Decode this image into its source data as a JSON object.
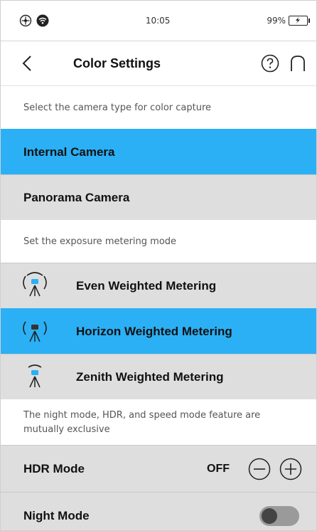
{
  "statusbar": {
    "time": "10:05",
    "battery": "99%"
  },
  "header": {
    "title": "Color Settings"
  },
  "camera": {
    "caption": "Select the camera type for color capture",
    "options": [
      {
        "label": "Internal Camera",
        "selected": true
      },
      {
        "label": "Panorama Camera",
        "selected": false
      }
    ]
  },
  "metering": {
    "caption": "Set the exposure metering mode",
    "options": [
      {
        "label": "Even Weighted Metering",
        "selected": false,
        "icon": "even-metering-icon"
      },
      {
        "label": "Horizon Weighted Metering",
        "selected": true,
        "icon": "horizon-metering-icon"
      },
      {
        "label": "Zenith Weighted Metering",
        "selected": false,
        "icon": "zenith-metering-icon"
      }
    ]
  },
  "modes": {
    "caption": "The night mode, HDR, and speed mode feature are mutually exclusive",
    "hdr": {
      "label": "HDR Mode",
      "value": "OFF"
    },
    "night": {
      "label": "Night Mode",
      "enabled": false
    }
  },
  "colors": {
    "accent": "#2bb0f5",
    "row": "#dedede",
    "knob": "#444444",
    "track": "#9a9a9a"
  }
}
